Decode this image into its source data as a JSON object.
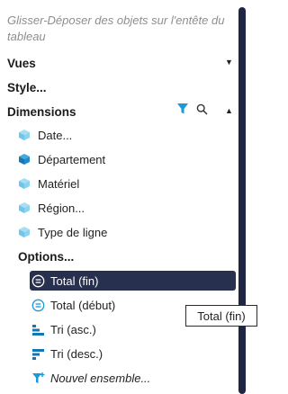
{
  "hint": "Glisser-Déposer des objets sur l'entête du tableau",
  "sections": {
    "vues": "Vues",
    "style": "Style...",
    "dimensions": "Dimensions",
    "options": "Options..."
  },
  "dimension_items": [
    {
      "label": "Date...",
      "icon": "cube-light-icon"
    },
    {
      "label": "Département",
      "icon": "cube-dark-icon"
    },
    {
      "label": "Matériel",
      "icon": "cube-light-icon"
    },
    {
      "label": "Région...",
      "icon": "cube-light-icon"
    },
    {
      "label": "Type de ligne",
      "icon": "cube-light-icon"
    }
  ],
  "option_items": [
    {
      "label": "Total (fin)",
      "icon": "equals-circle-icon",
      "selected": true
    },
    {
      "label": "Total (début)",
      "icon": "equals-circle-icon"
    },
    {
      "label": "Tri (asc.)",
      "icon": "sort-asc-icon"
    },
    {
      "label": "Tri (desc.)",
      "icon": "sort-desc-icon"
    },
    {
      "label": "Nouvel ensemble...",
      "icon": "funnel-plus-icon"
    }
  ],
  "tooltip": "Total (fin)",
  "colors": {
    "accent": "#1a9ad6",
    "selected_bg": "#27304e",
    "scrollbar": "#1f2544"
  }
}
